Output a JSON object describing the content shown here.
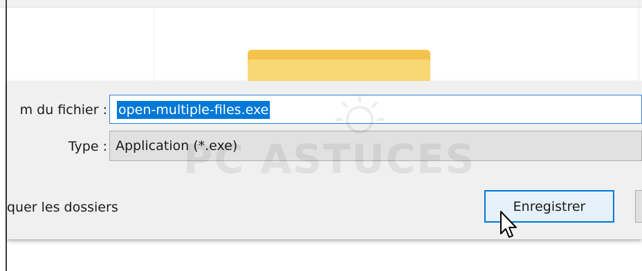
{
  "dialog": {
    "filename_label": "m du fichier :",
    "filename_value": "open-multiple-files.exe",
    "type_label": "Type :",
    "type_value": "Application (*.exe)",
    "hide_folders_label": "quer les dossiers",
    "save_button_label": "Enregistrer"
  },
  "watermark": {
    "text": "PC ASTUCES",
    "icon": "sun-logo-icon"
  },
  "icons": {
    "folder": "folder-icon",
    "cursor": "mouse-pointer-icon"
  },
  "colors": {
    "accent": "#0078d7",
    "panel_bg": "#f0f0f0",
    "folder_yellow": "#f4c34b"
  }
}
